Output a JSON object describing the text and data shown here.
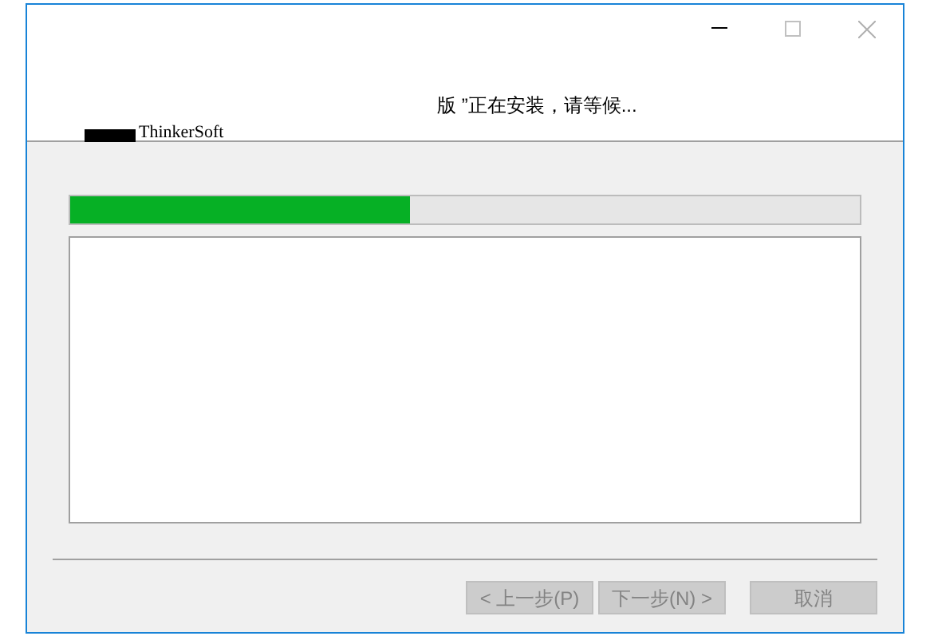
{
  "header": {
    "status": "版 ”正在安装，请等候...",
    "logo_text": "ThinkerSoft"
  },
  "progress": {
    "level": 0.43
  },
  "buttons": [
    {
      "label": "< 上一步(P)",
      "disabled": true
    },
    {
      "label": "下一步(N) >",
      "disabled": true
    },
    {
      "label": "取消",
      "disabled": true
    }
  ]
}
